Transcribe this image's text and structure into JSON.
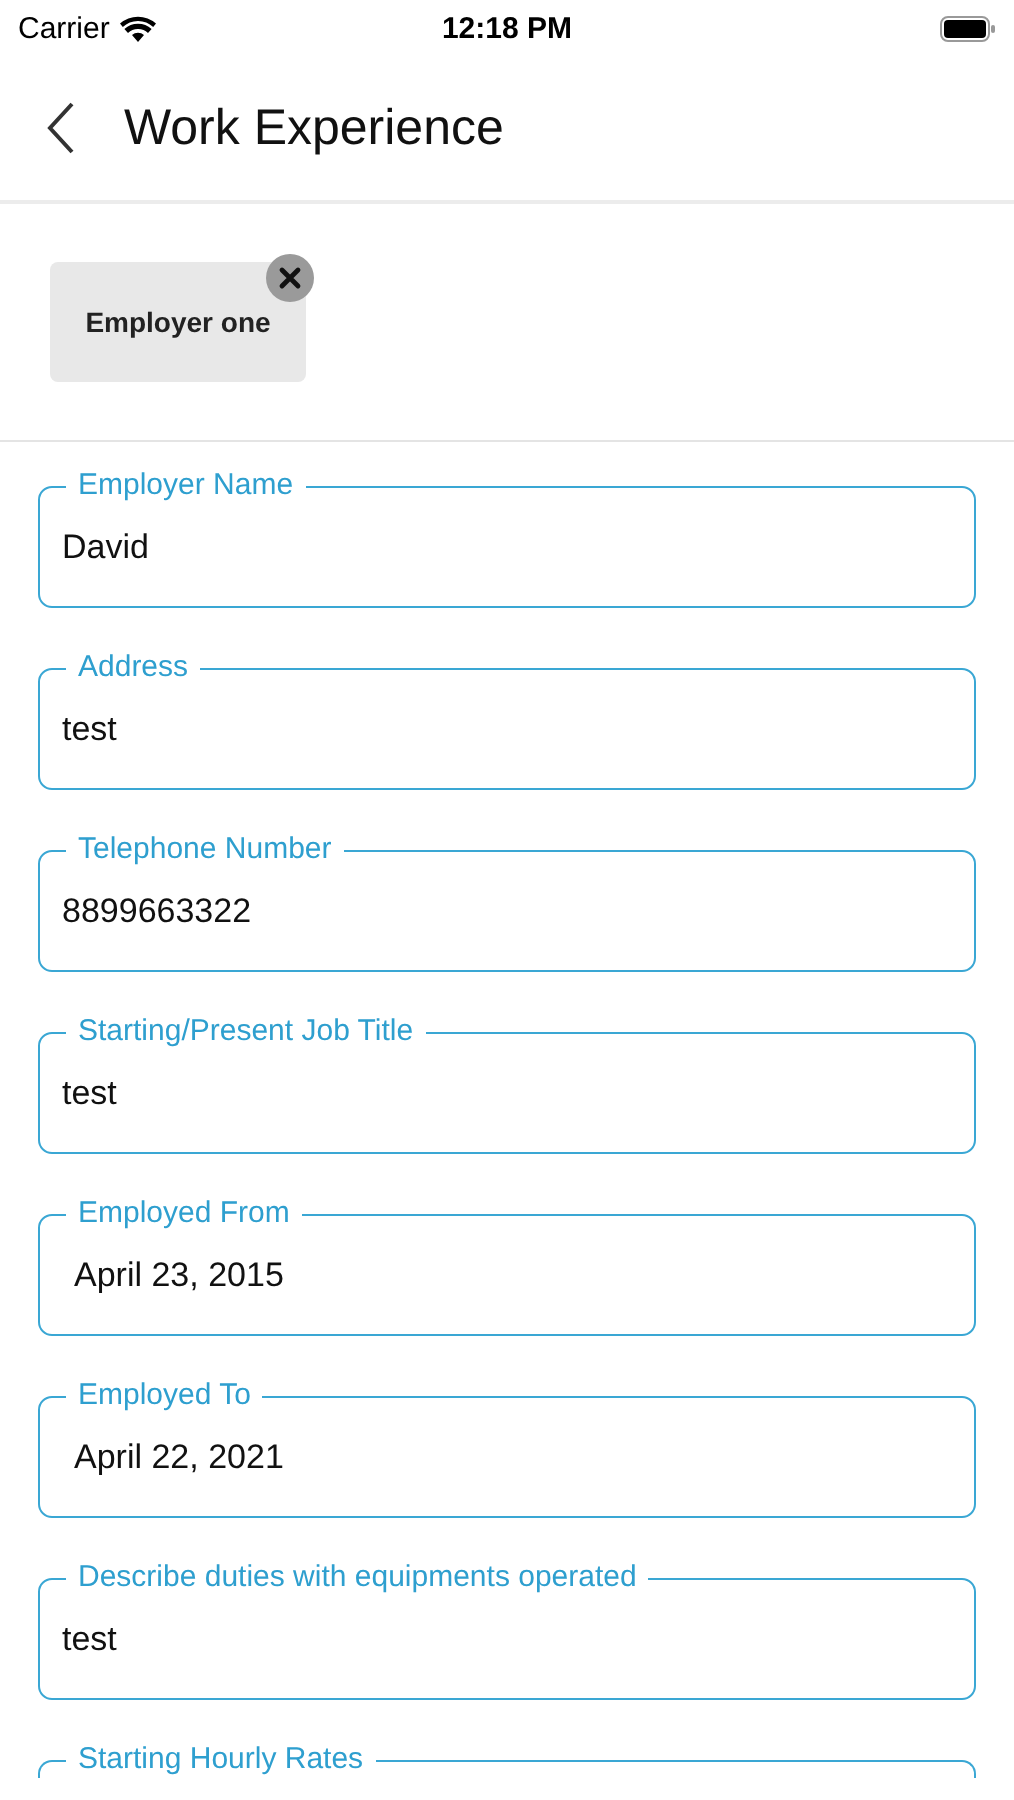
{
  "status_bar": {
    "carrier": "Carrier",
    "time": "12:18 PM"
  },
  "header": {
    "title": "Work Experience"
  },
  "chips": [
    {
      "label": "Employer one"
    }
  ],
  "fields": [
    {
      "label": "Employer Name",
      "value": "David",
      "kind": "text"
    },
    {
      "label": "Address",
      "value": "test",
      "kind": "text"
    },
    {
      "label": "Telephone Number",
      "value": "8899663322",
      "kind": "text"
    },
    {
      "label": "Starting/Present Job Title",
      "value": "test",
      "kind": "text"
    },
    {
      "label": "Employed From",
      "value": "April 23, 2015",
      "kind": "date"
    },
    {
      "label": "Employed To",
      "value": "April 22, 2021",
      "kind": "date"
    },
    {
      "label": "Describe duties with equipments operated",
      "value": "test",
      "kind": "text"
    },
    {
      "label": "Starting Hourly Rates",
      "kind": "text"
    }
  ]
}
